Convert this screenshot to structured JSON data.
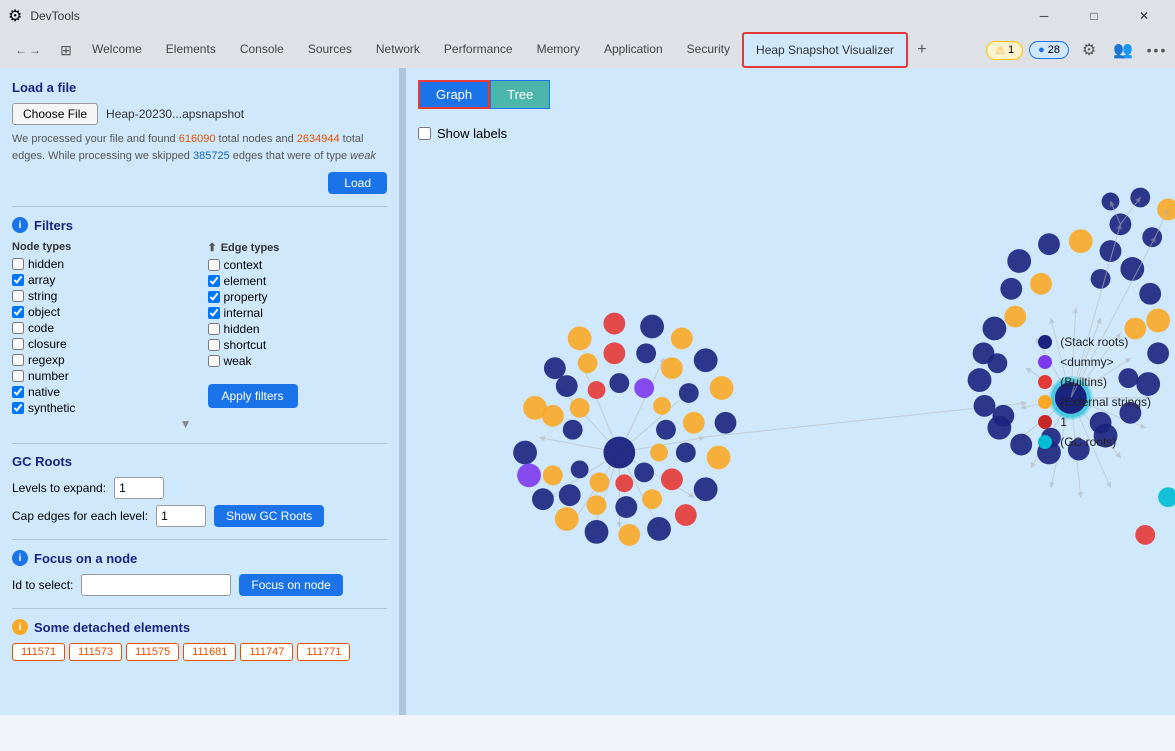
{
  "titlebar": {
    "title": "DevTools",
    "min_btn": "─",
    "max_btn": "□",
    "close_btn": "✕"
  },
  "tabs": [
    {
      "label": "Welcome",
      "active": false
    },
    {
      "label": "Elements",
      "active": false
    },
    {
      "label": "Console",
      "active": false
    },
    {
      "label": "Sources",
      "active": false
    },
    {
      "label": "Network",
      "active": false
    },
    {
      "label": "Performance",
      "active": false
    },
    {
      "label": "Memory",
      "active": false
    },
    {
      "label": "Application",
      "active": false
    },
    {
      "label": "Security",
      "active": false
    },
    {
      "label": "Heap Snapshot Visualizer",
      "active": true
    }
  ],
  "toolbar": {
    "add_icon": "+",
    "warning_count": "1",
    "error_count": "28"
  },
  "left_panel": {
    "file_section": {
      "title": "Load a file",
      "choose_file_btn": "Choose File",
      "file_name": "Heap-20230...apsnapshot",
      "info_text_before": "We processed your file and found ",
      "total_nodes": "616090",
      "info_text_middle": " total nodes and ",
      "total_edges": "2634944",
      "info_text_after": " total edges. While processing we skipped ",
      "skipped_edges": "385725",
      "info_text_end": " edges that were of type ",
      "edge_type_weak": "weak",
      "load_btn": "Load"
    },
    "filters": {
      "section_title": "Filters",
      "node_types_title": "Node types",
      "node_types": [
        {
          "label": "hidden",
          "checked": false
        },
        {
          "label": "array",
          "checked": true
        },
        {
          "label": "string",
          "checked": false
        },
        {
          "label": "object",
          "checked": true
        },
        {
          "label": "code",
          "checked": false
        },
        {
          "label": "closure",
          "checked": false
        },
        {
          "label": "regexp",
          "checked": false
        },
        {
          "label": "number",
          "checked": false
        },
        {
          "label": "native",
          "checked": true
        },
        {
          "label": "synthetic",
          "checked": true
        }
      ],
      "edge_types_title": "Edge types",
      "edge_types": [
        {
          "label": "context",
          "checked": false
        },
        {
          "label": "element",
          "checked": true
        },
        {
          "label": "property",
          "checked": true
        },
        {
          "label": "internal",
          "checked": true
        },
        {
          "label": "hidden",
          "checked": false
        },
        {
          "label": "shortcut",
          "checked": false
        },
        {
          "label": "weak",
          "checked": false
        }
      ],
      "apply_btn": "Apply filters"
    },
    "gc_roots": {
      "title": "GC Roots",
      "levels_label": "Levels to expand:",
      "levels_value": "1",
      "cap_label": "Cap edges for each level:",
      "cap_value": "1",
      "show_btn": "Show GC Roots"
    },
    "focus_node": {
      "title": "Focus on a node",
      "id_label": "Id to select:",
      "input_placeholder": "",
      "focus_btn": "Focus on node"
    },
    "detached": {
      "title": "Some detached elements",
      "tags": [
        "111571",
        "111573",
        "111575",
        "111681",
        "111747",
        "111771"
      ]
    }
  },
  "graph_panel": {
    "view_graph_btn": "Graph",
    "view_tree_btn": "Tree",
    "show_labels_label": "Show labels",
    "legend": [
      {
        "label": "(Stack roots)",
        "color": "#1a237e"
      },
      {
        "label": "<dummy>",
        "color": "#7c3aed"
      },
      {
        "label": "(Builtins)",
        "color": "#e53935"
      },
      {
        "label": "(External strings)",
        "color": "#f9a825"
      },
      {
        "label": "1",
        "color": "#c62828"
      },
      {
        "label": "(GC roots)",
        "color": "#00bcd4"
      }
    ]
  }
}
